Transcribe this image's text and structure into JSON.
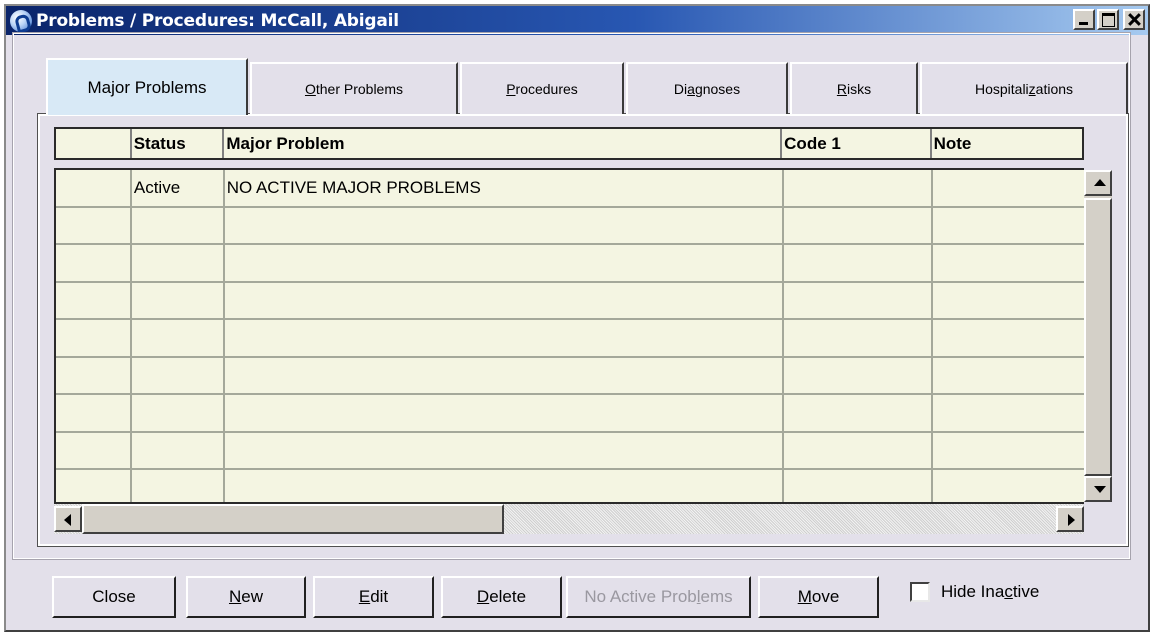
{
  "window": {
    "title": "Problems / Procedures: McCall, Abigail"
  },
  "tabs": [
    {
      "pre": "Major Problems",
      "key": "",
      "post": "",
      "active": true
    },
    {
      "pre": "",
      "key": "O",
      "post": "ther Problems",
      "active": false
    },
    {
      "pre": "",
      "key": "P",
      "post": "rocedures",
      "active": false
    },
    {
      "pre": "Di",
      "key": "a",
      "post": "gnoses",
      "active": false
    },
    {
      "pre": "",
      "key": "R",
      "post": "isks",
      "active": false
    },
    {
      "pre": "Hospitali",
      "key": "z",
      "post": "ations",
      "active": false
    }
  ],
  "grid": {
    "columns": [
      "",
      "Status",
      "Major Problem",
      "Code 1",
      "Note"
    ],
    "rows": [
      [
        "",
        "Active",
        "NO ACTIVE MAJOR PROBLEMS",
        "",
        ""
      ],
      [
        "",
        "",
        "",
        "",
        ""
      ],
      [
        "",
        "",
        "",
        "",
        ""
      ],
      [
        "",
        "",
        "",
        "",
        ""
      ],
      [
        "",
        "",
        "",
        "",
        ""
      ],
      [
        "",
        "",
        "",
        "",
        ""
      ],
      [
        "",
        "",
        "",
        "",
        ""
      ],
      [
        "",
        "",
        "",
        "",
        ""
      ],
      [
        "",
        "",
        "",
        "",
        ""
      ]
    ]
  },
  "buttons": {
    "close": {
      "pre": "Close",
      "key": "",
      "post": ""
    },
    "new": {
      "pre": "",
      "key": "N",
      "post": "ew"
    },
    "edit": {
      "pre": "",
      "key": "E",
      "post": "dit"
    },
    "delete": {
      "pre": "",
      "key": "D",
      "post": "elete"
    },
    "no_active": {
      "pre": "No Active Prob",
      "key": "l",
      "post": "ems"
    },
    "move": {
      "pre": "",
      "key": "M",
      "post": "ove"
    }
  },
  "hide_inactive": {
    "pre": "Hide Ina",
    "key": "c",
    "post": "tive",
    "checked": false
  }
}
